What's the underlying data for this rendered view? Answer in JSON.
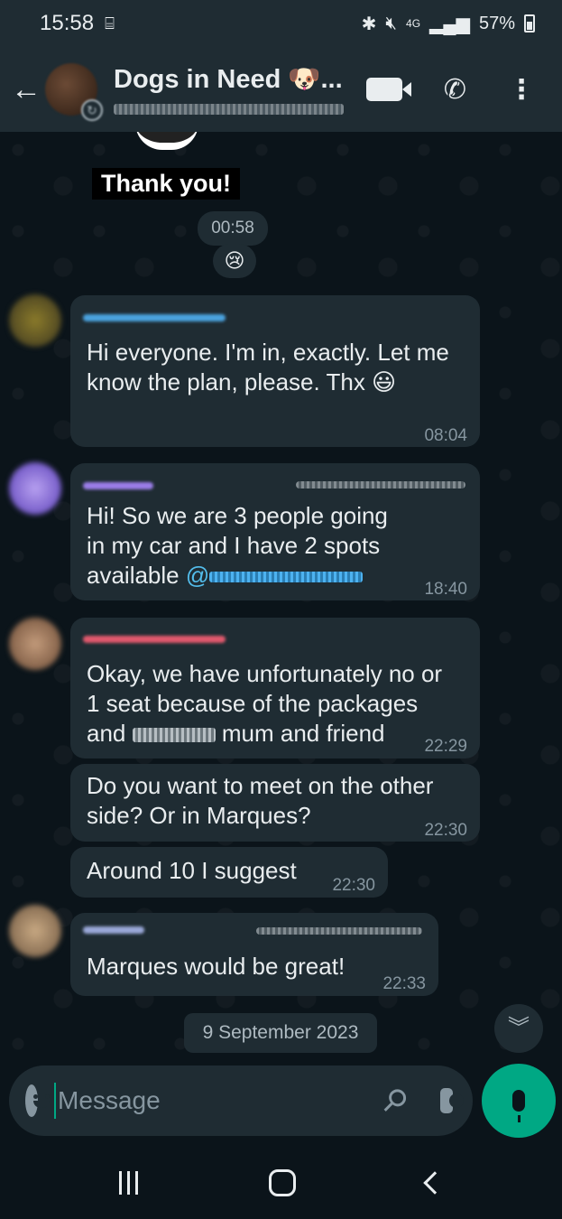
{
  "status_bar": {
    "time": "15:58",
    "network": "4G",
    "battery": "57%"
  },
  "header": {
    "group_name": "Dogs in Need 🐶...",
    "back_icon": "arrow-left-icon",
    "video_icon": "video-camera-icon",
    "call_icon": "phone-icon",
    "menu_icon": "more-vertical-icon"
  },
  "sticker": {
    "caption": "Thank you!",
    "time": "00:58",
    "reaction": "😢"
  },
  "messages": [
    {
      "line1": "Hi everyone. I'm in, exactly. Let me",
      "line2": "know the plan, please. Thx 😃",
      "time": "08:04",
      "sender_color": "#4aa3df"
    },
    {
      "line1": "Hi! So we are 3 people going",
      "line2": "in my car and I have 2 spots",
      "line3": "available",
      "mention": "@",
      "time": "18:40",
      "sender_color": "#9b7ee8"
    },
    {
      "line1": "Okay, we have unfortunately no or",
      "line2": "1 seat because of the packages",
      "line3a": "and",
      "line3b": "mum and friend",
      "time": "22:29",
      "sender_color": "#e0596d"
    },
    {
      "line1": "Do you want to meet on the other",
      "line2": "side? Or in Marques?",
      "time": "22:30"
    },
    {
      "line1": "Around 10 I suggest",
      "time": "22:30"
    },
    {
      "line1": "Marques would be great!",
      "time": "22:33",
      "sender_color": "#9aa8d8"
    }
  ],
  "date_chip": "9 September 2023",
  "composer": {
    "placeholder": "Message",
    "emoji_icon": "emoji-icon",
    "attach_icon": "paperclip-icon",
    "camera_icon": "camera-icon",
    "mic_icon": "microphone-icon"
  },
  "colors": {
    "accent": "#00a884",
    "bubble": "#1f2c33",
    "background": "#0b141a",
    "mention": "#53bdeb"
  }
}
